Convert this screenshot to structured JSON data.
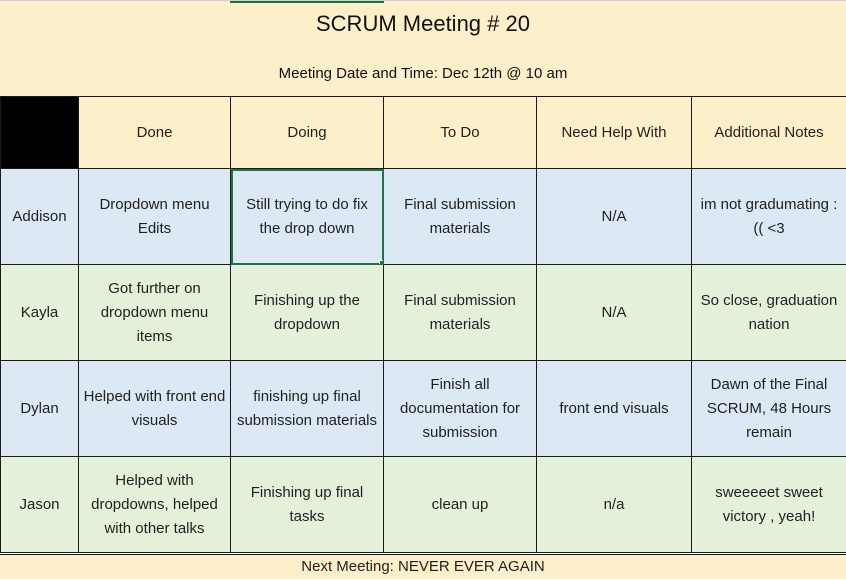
{
  "title": "SCRUM Meeting # 20",
  "subtitle": "Meeting Date and Time: Dec 12th @ 10 am",
  "columns": [
    "Done",
    "Doing",
    "To Do",
    "Need Help With",
    "Additional Notes"
  ],
  "rows": [
    {
      "name": "Addison",
      "done": "Dropdown menu Edits",
      "doing": "Still trying to do fix the drop down",
      "todo": "Final submission materials",
      "help": "N/A",
      "notes": "im not gradumating :(( <3"
    },
    {
      "name": "Kayla",
      "done": "Got further on dropdown menu items",
      "doing": "Finishing up the dropdown",
      "todo": "Final submission materials",
      "help": "N/A",
      "notes": "So close, graduation nation"
    },
    {
      "name": "Dylan",
      "done": "Helped with front end visuals",
      "doing": "finishing up final submission materials",
      "todo": "Finish all documentation for submission",
      "help": "front end visuals",
      "notes": "Dawn of the Final SCRUM, 48 Hours remain"
    },
    {
      "name": "Jason",
      "done": "Helped with dropdowns, helped with other talks",
      "doing": "Finishing up final tasks",
      "todo": "clean up",
      "help": "n/a",
      "notes": "sweeeeet sweet victory , yeah!"
    }
  ],
  "footer": "Next Meeting: NEVER EVER AGAIN",
  "colors": {
    "header_bg": "#fdefc9",
    "row_blue": "#dde8f5",
    "row_green": "#e3f0da",
    "selection": "#217346"
  }
}
